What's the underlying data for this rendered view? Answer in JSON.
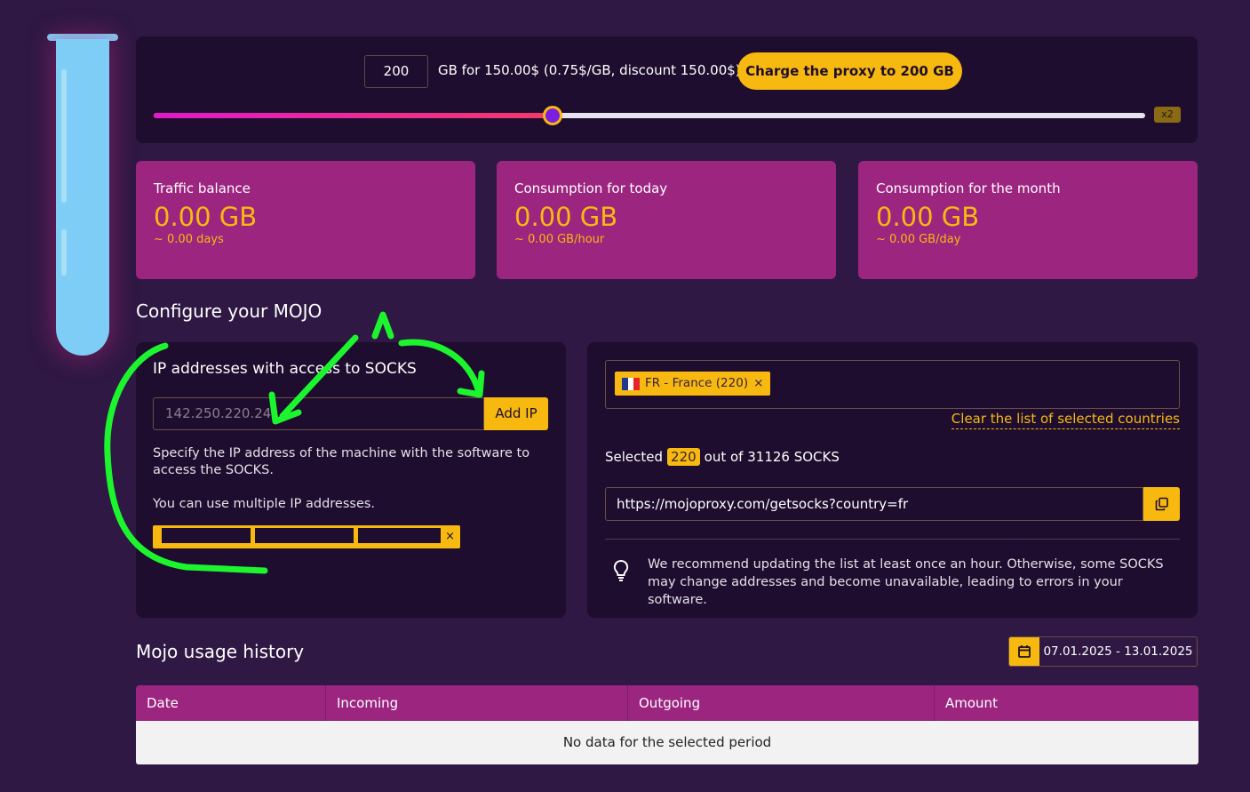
{
  "charge": {
    "gb_value": "200",
    "price_text": "GB for 150.00$ (0.75$/GB, discount 150.00$)",
    "button_label": "Charge the proxy to 200 GB",
    "slider_fraction": 0.402,
    "multiplier_badge": "x2"
  },
  "stats": [
    {
      "label": "Traffic balance",
      "value": "0.00 GB",
      "sub": "~ 0.00 days"
    },
    {
      "label": "Consumption for today",
      "value": "0.00 GB",
      "sub": "~ 0.00 GB/hour"
    },
    {
      "label": "Consumption for the month",
      "value": "0.00 GB",
      "sub": "~ 0.00 GB/day"
    }
  ],
  "configure_title": "Configure your MOJO",
  "ip": {
    "heading": "IP addresses with access to SOCKS",
    "placeholder": "142.250.220.24",
    "add_button": "Add IP",
    "help": "Specify the IP address of the machine with the software to access the SOCKS.",
    "help2": "You can use multiple IP addresses.",
    "chip_remove": "×"
  },
  "countries": {
    "chip_label": "FR - France (220)",
    "chip_remove": "×",
    "clear_link": "Clear the list of selected countries",
    "selected_prefix": "Selected",
    "selected_count": "220",
    "selected_suffix": "out of 31126 SOCKS",
    "url": "https://mojoproxy.com/getsocks?country=fr",
    "recommendation": "We recommend updating the list at least once an hour. Otherwise, some SOCKS may change addresses and become unavailable, leading to errors in your software.",
    "flag_colors": [
      "#1f3a93",
      "#ffffff",
      "#e5252a"
    ]
  },
  "history": {
    "title": "Mojo usage history",
    "date_range": "07.01.2025 - 13.01.2025",
    "columns": [
      "Date",
      "Incoming",
      "Outgoing",
      "Amount"
    ],
    "empty_message": "No data for the selected period"
  },
  "colors": {
    "background": "#2f1843",
    "panel": "#1e0d2e",
    "accent_yellow": "#f7b90f",
    "card_magenta": "#9c2580",
    "annotation_green": "#1cf52e"
  }
}
